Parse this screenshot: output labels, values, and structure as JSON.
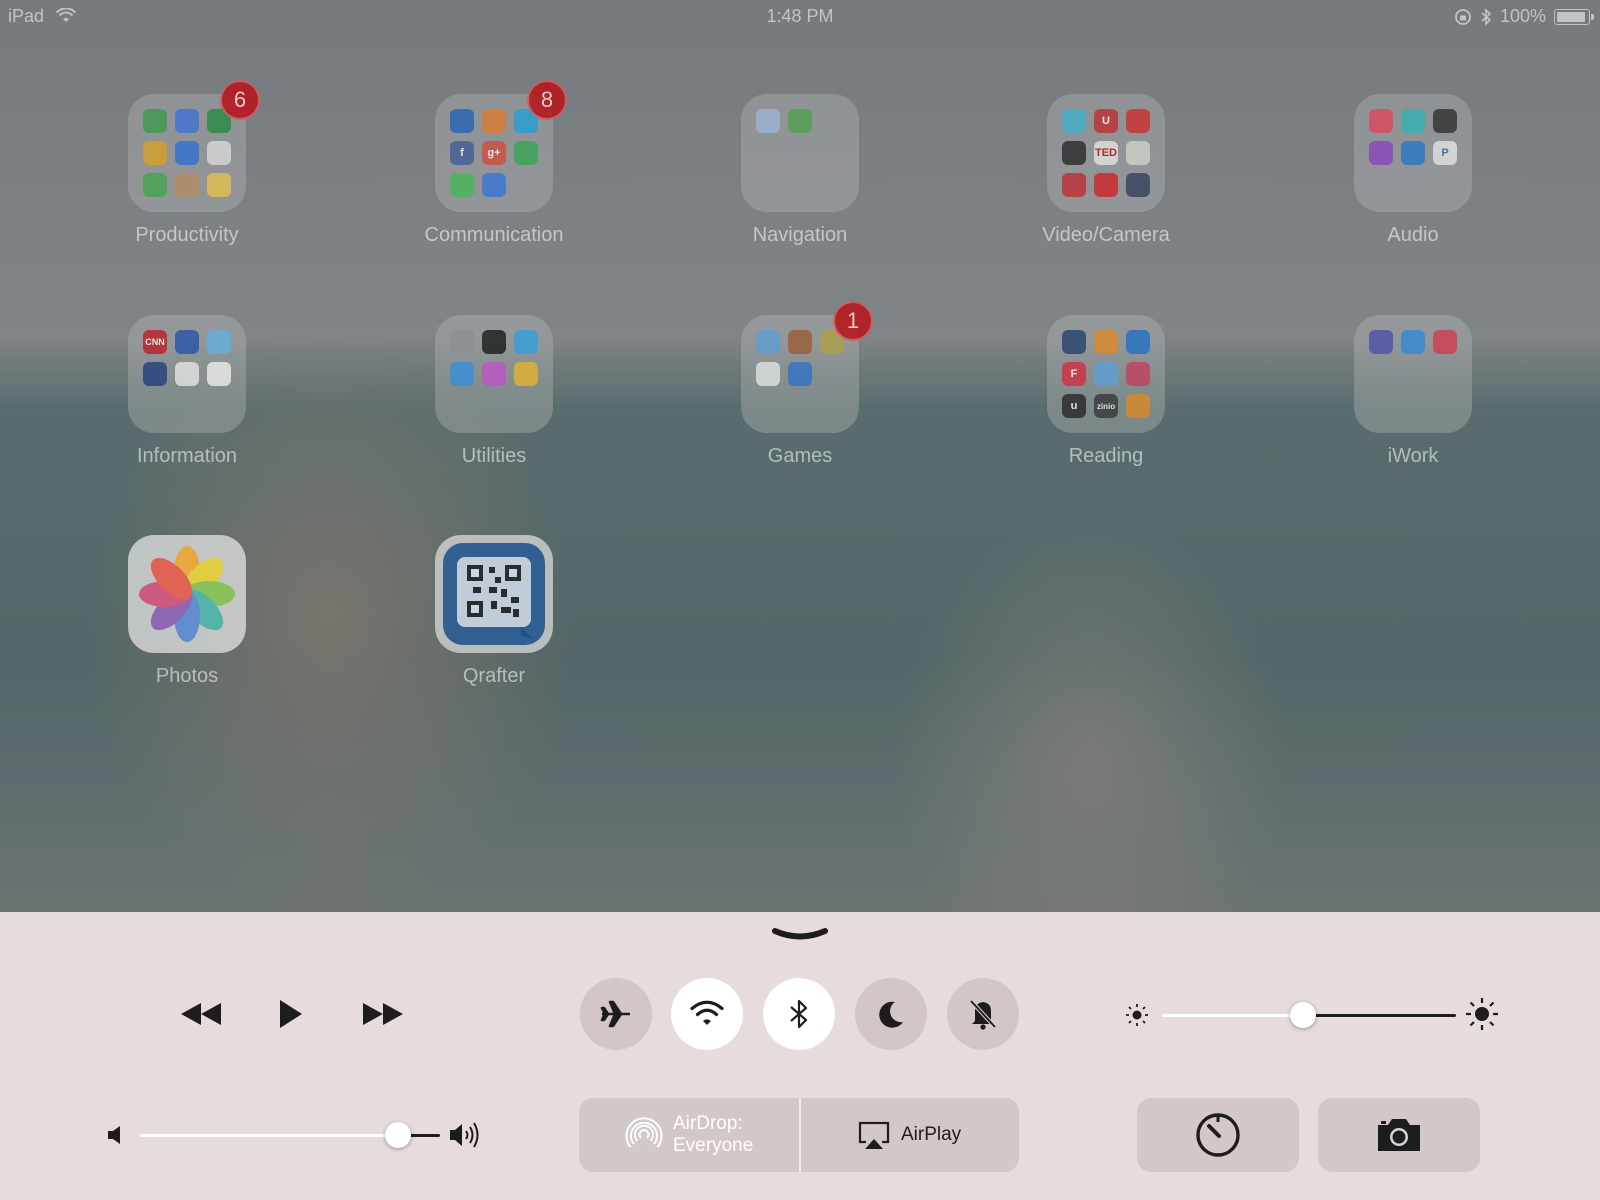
{
  "status_bar": {
    "device": "iPad",
    "time": "1:48 PM",
    "battery_text": "100%",
    "battery_level": 1.0
  },
  "home": {
    "folders": [
      {
        "label": "Productivity",
        "badge": "6"
      },
      {
        "label": "Communication",
        "badge": "8"
      },
      {
        "label": "Navigation",
        "badge": ""
      },
      {
        "label": "Video/Camera",
        "badge": ""
      },
      {
        "label": "Audio",
        "badge": ""
      },
      {
        "label": "Information",
        "badge": ""
      },
      {
        "label": "Utilities",
        "badge": ""
      },
      {
        "label": "Games",
        "badge": "1"
      },
      {
        "label": "Reading",
        "badge": ""
      },
      {
        "label": "iWork",
        "badge": ""
      }
    ],
    "apps": [
      {
        "label": "Photos"
      },
      {
        "label": "Qrafter"
      }
    ]
  },
  "control_center": {
    "toggles": [
      {
        "name": "airplane-mode",
        "icon": "airplane-icon",
        "on": false
      },
      {
        "name": "wifi",
        "icon": "wifi-icon",
        "on": true
      },
      {
        "name": "bluetooth",
        "icon": "bluetooth-icon",
        "on": true
      },
      {
        "name": "do-not-disturb",
        "icon": "moon-icon",
        "on": false
      },
      {
        "name": "mute",
        "icon": "bell-slash-icon",
        "on": false
      }
    ],
    "brightness_level": 0.48,
    "volume_level": 0.86,
    "airdrop": {
      "line1": "AirDrop:",
      "line2": "Everyone"
    },
    "airplay": {
      "label": "AirPlay"
    }
  },
  "colors": {
    "badge": "#b51a1f",
    "toggle_on": "#ffffff",
    "icon_dark": "#1d1d1d"
  }
}
